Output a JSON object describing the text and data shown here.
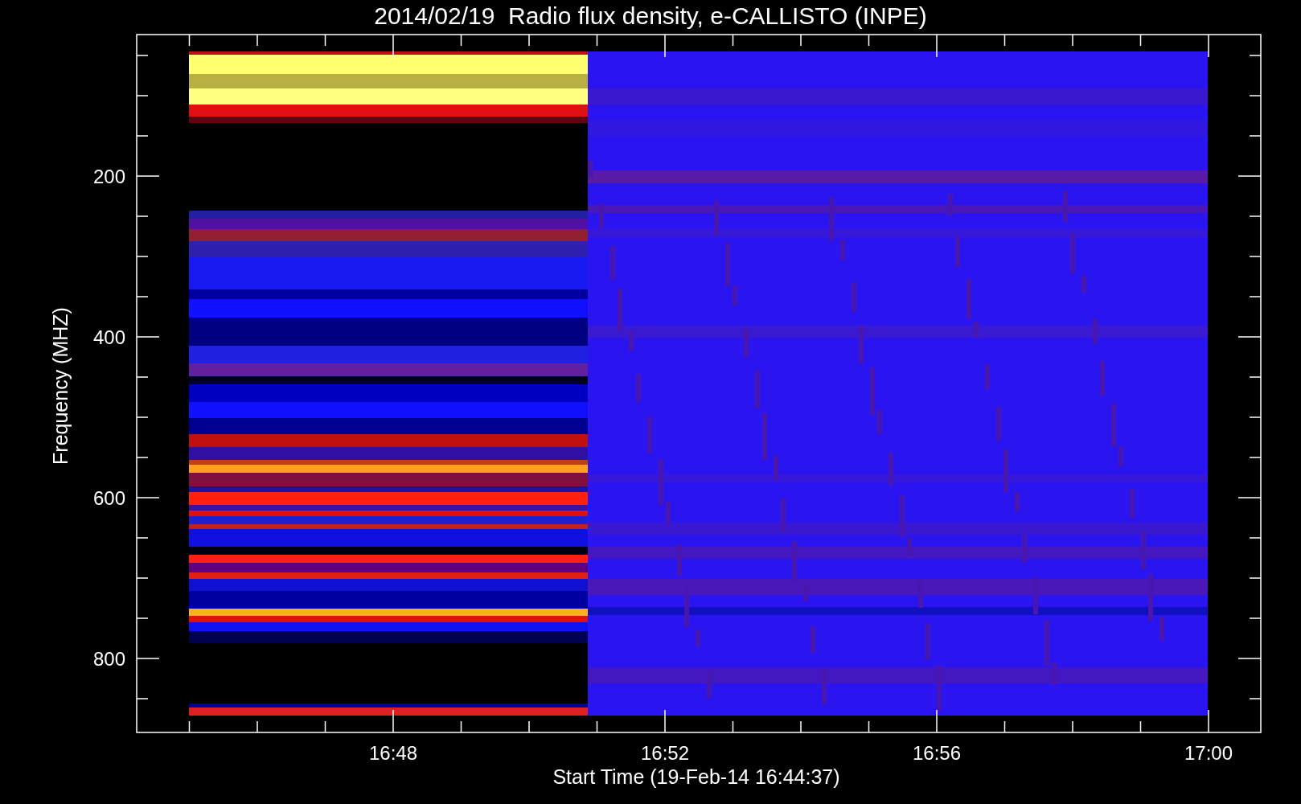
{
  "plot": {
    "title": "2014/02/19  Radio flux density, e-CALLISTO (INPE)",
    "ylabel": "Frequency (MHZ)",
    "xlabel": "Start Time (19-Feb-14 16:44:37)",
    "yticks": [
      "200",
      "400",
      "600",
      "800"
    ],
    "xticks": [
      "16:48",
      "16:52",
      "16:56",
      "17:00"
    ]
  }
}
